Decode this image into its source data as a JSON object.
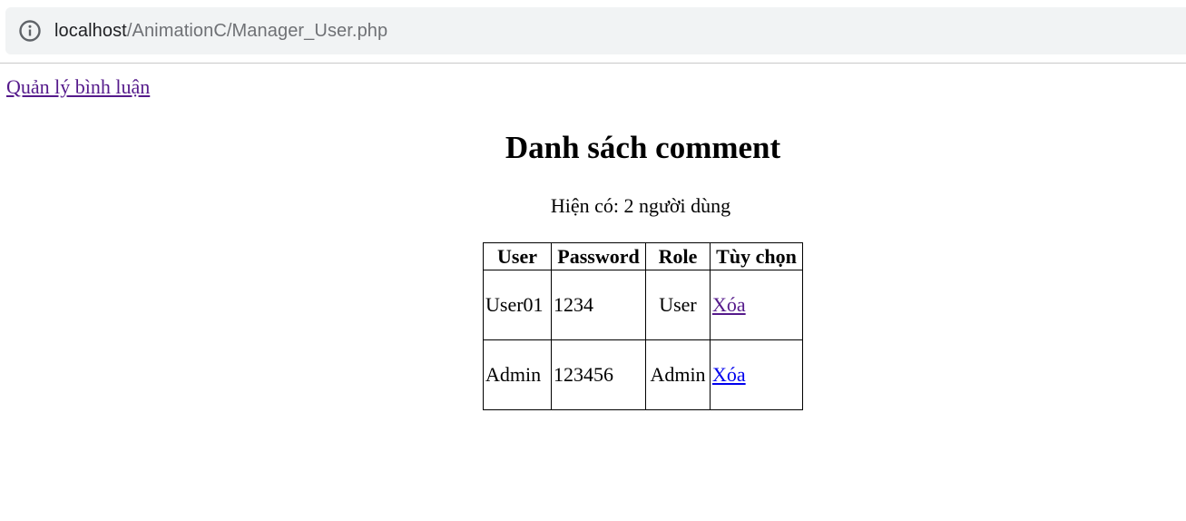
{
  "browser": {
    "url_host": "localhost",
    "url_path": "/AnimationC/Manager_User.php",
    "info_icon": "info-icon"
  },
  "page": {
    "top_link": "Quản lý bình luận",
    "title": "Danh sách comment",
    "count_text": "Hiện có: 2 người dùng",
    "table": {
      "headers": [
        "User",
        "Password",
        "Role",
        "Tùy chọn"
      ],
      "rows": [
        {
          "user": "User01",
          "password": "1234",
          "role": "User",
          "action": "Xóa"
        },
        {
          "user": "Admin",
          "password": "123456",
          "role": "Admin",
          "action": "Xóa"
        }
      ]
    }
  },
  "colors": {
    "visited_link": "#551a8b",
    "unvisited_link": "#0000ee",
    "address_bar_bg": "#f1f3f4"
  }
}
